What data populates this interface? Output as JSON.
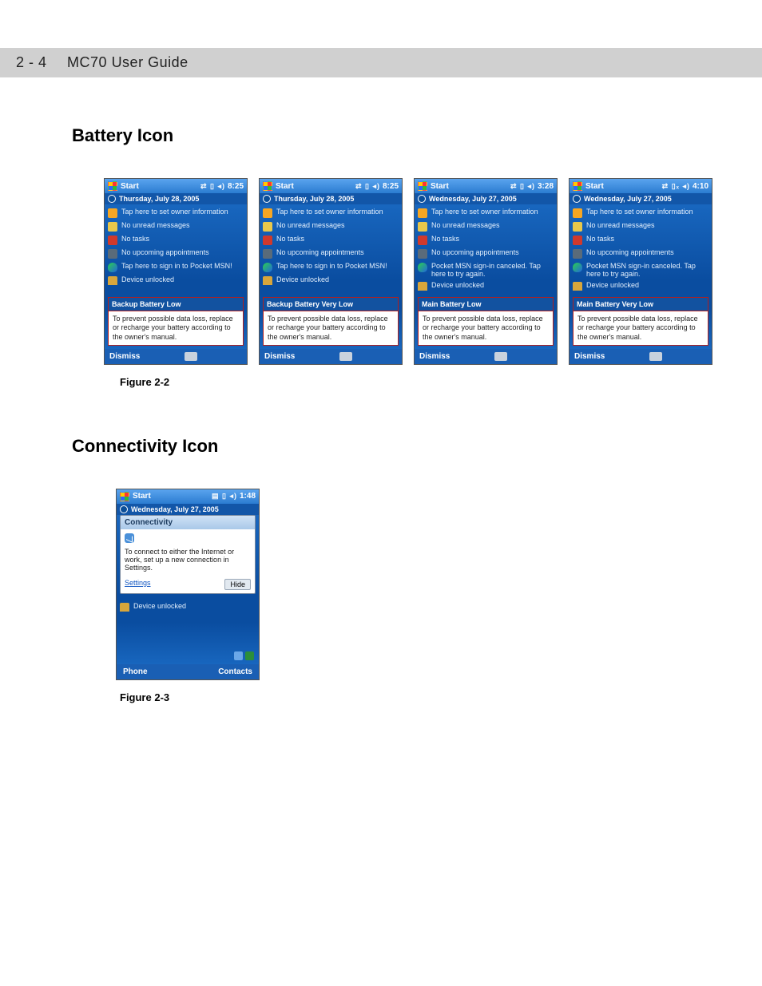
{
  "header": {
    "page_num": "2 - 4",
    "title": "MC70 User Guide"
  },
  "section1": {
    "title": "Battery Icon",
    "figure": "Figure 2-2"
  },
  "section2": {
    "title": "Connectivity Icon",
    "figure": "Figure 2-3"
  },
  "common": {
    "start": "Start",
    "owner": "Tap here to set owner information",
    "mail": "No unread messages",
    "tasks": "No tasks",
    "appt": "No upcoming appointments",
    "msn": "Tap here to sign in to Pocket MSN!",
    "msn_cancel": "Pocket MSN sign-in canceled. Tap here to try again.",
    "unlock": "Device unlocked",
    "alert_body": "To prevent possible data loss, replace or recharge your battery according to the owner's manual.",
    "dismiss": "Dismiss"
  },
  "shots": [
    {
      "time": "8:25",
      "icons": "⇄ ▯ ◂)",
      "date": "Thursday, July 28, 2005",
      "msn_key": "msn",
      "alert": "Backup Battery Low"
    },
    {
      "time": "8:25",
      "icons": "⇄ ▯ ◂)",
      "date": "Thursday, July 28, 2005",
      "msn_key": "msn",
      "alert": "Backup Battery Very Low"
    },
    {
      "time": "3:28",
      "icons": "⇄ ▯ ◂)",
      "date": "Wednesday, July 27, 2005",
      "msn_key": "msn_cancel",
      "alert": "Main Battery Low"
    },
    {
      "time": "4:10",
      "icons": "⇄ ▯ₓ ◂)",
      "date": "Wednesday, July 27, 2005",
      "msn_key": "msn_cancel",
      "alert": "Main Battery Very Low"
    }
  ],
  "conn": {
    "time": "1:48",
    "icons": "▤ ▯ ◂)",
    "date": "Wednesday, July 27, 2005",
    "popup_title": "Connectivity",
    "popup_body": "To connect to either the Internet or work, set up a new connection in Settings.",
    "settings": "Settings",
    "hide": "Hide",
    "left": "Phone",
    "right": "Contacts"
  }
}
